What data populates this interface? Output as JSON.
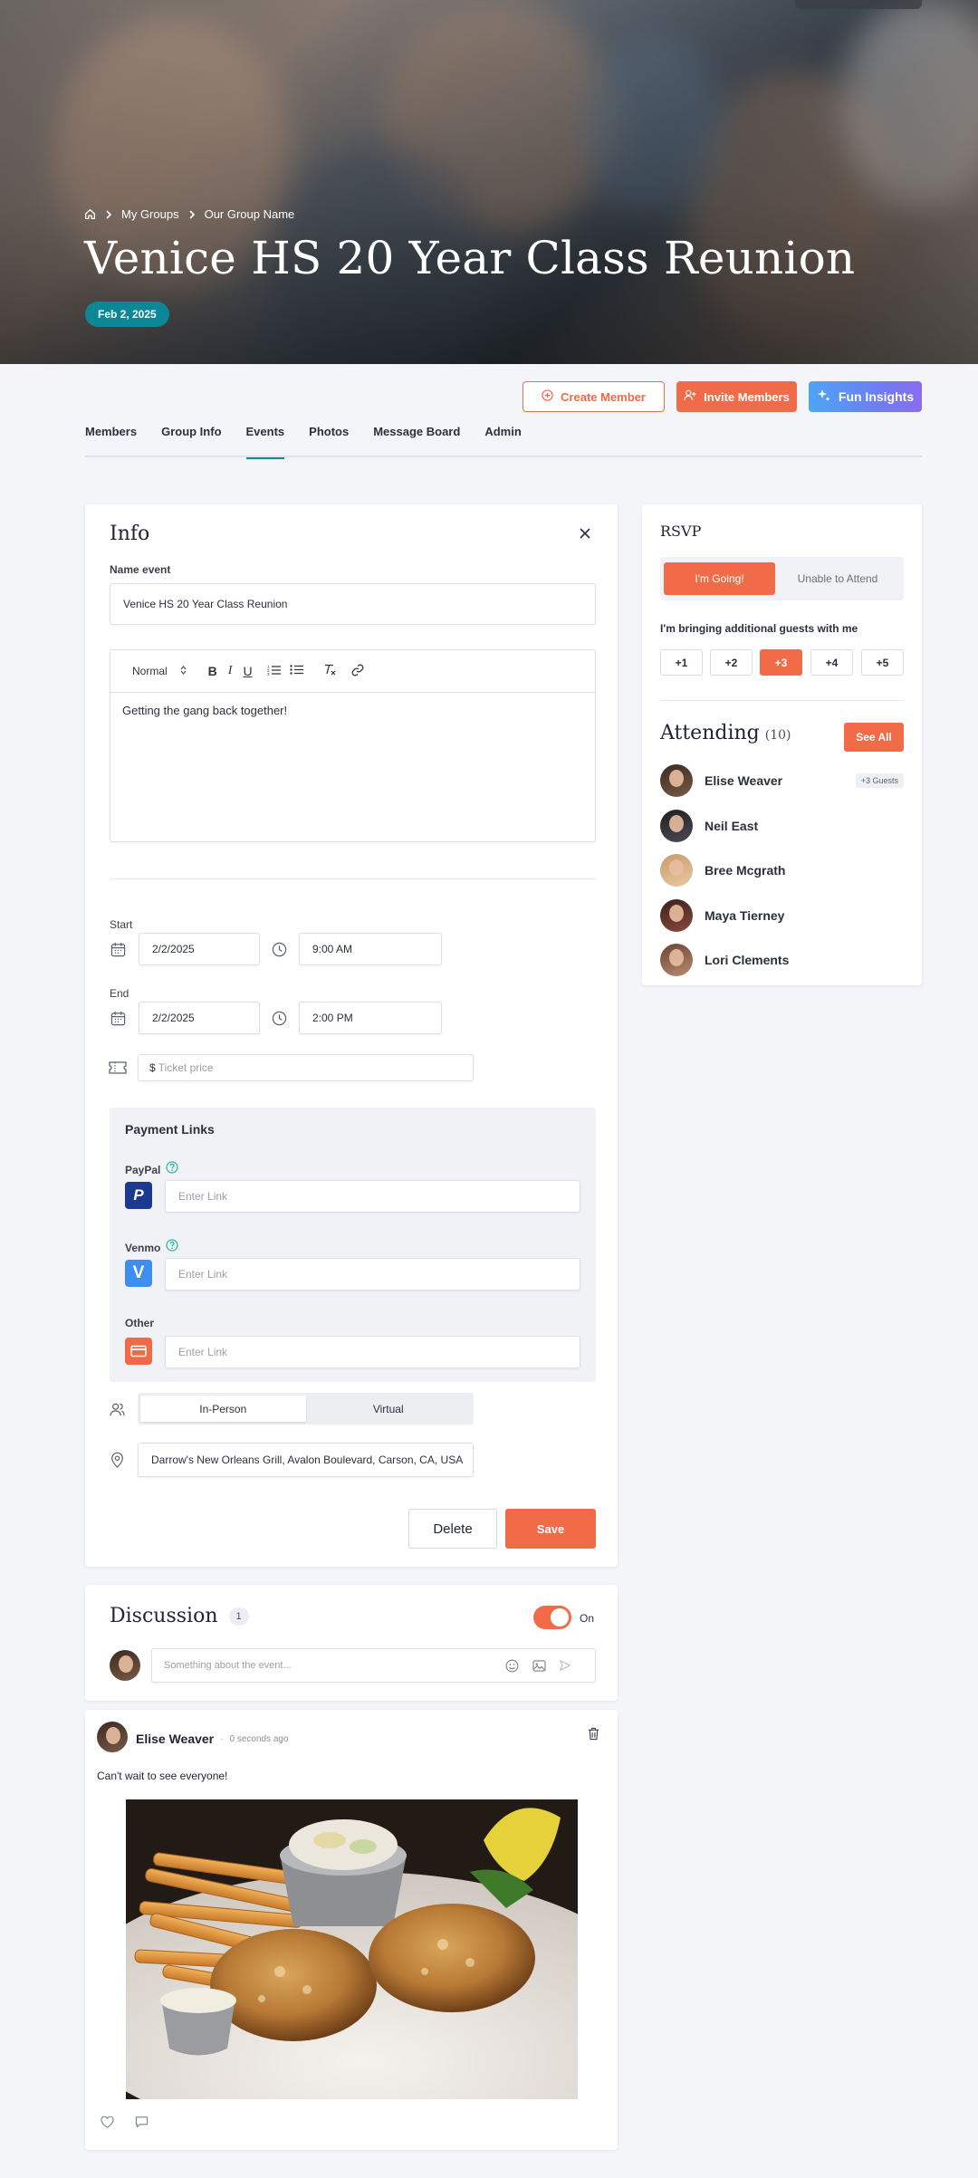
{
  "hero": {
    "breadcrumb": [
      "My Groups",
      "Our Group Name"
    ],
    "title": "Venice HS 20 Year Class Reunion",
    "date": "Feb 2, 2025"
  },
  "actions": {
    "create_member": "Create Member",
    "invite_members": "Invite Members",
    "fun_insights": "Fun Insights"
  },
  "tabs": [
    {
      "label": "Members"
    },
    {
      "label": "Group Info"
    },
    {
      "label": "Events",
      "active": true
    },
    {
      "label": "Photos"
    },
    {
      "label": "Message Board"
    },
    {
      "label": "Admin"
    }
  ],
  "info": {
    "title": "Info",
    "name_label": "Name event",
    "name_value": "Venice HS 20 Year Class Reunion",
    "editor": {
      "style": "Normal",
      "body": "Getting the gang back together!"
    },
    "start_label": "Start",
    "start_date": "2/2/2025",
    "start_time": "9:00 AM",
    "end_label": "End",
    "end_date": "2/2/2025",
    "end_time": "2:00 PM",
    "ticket_currency": "$",
    "ticket_placeholder": "Ticket price",
    "payment": {
      "title": "Payment Links",
      "paypal_label": "PayPal",
      "venmo_label": "Venmo",
      "other_label": "Other",
      "link_placeholder": "Enter Link"
    },
    "mode_options": [
      "In-Person",
      "Virtual"
    ],
    "mode_selected": "In-Person",
    "location": "Darrow's New Orleans Grill, Avalon Boulevard, Carson, CA, USA",
    "delete_label": "Delete",
    "save_label": "Save"
  },
  "rsvp": {
    "title": "RSVP",
    "going": "I'm Going!",
    "not_going": "Unable to Attend",
    "guests_label": "I'm bringing additional guests with me",
    "guest_options": [
      "+1",
      "+2",
      "+3",
      "+4",
      "+5"
    ],
    "guest_selected": "+3",
    "attending_title": "Attending",
    "attending_count": "(10)",
    "see_all": "See All",
    "attendees": [
      {
        "name": "Elise Weaver",
        "tag": "+3 Guests"
      },
      {
        "name": "Neil East"
      },
      {
        "name": "Bree Mcgrath"
      },
      {
        "name": "Maya Tierney"
      },
      {
        "name": "Lori Clements"
      }
    ]
  },
  "discussion": {
    "title": "Discussion",
    "count": "1",
    "toggle_label": "On",
    "toggle_on": true,
    "placeholder": "Something about the event..."
  },
  "post": {
    "author": "Elise Weaver",
    "separator": "·",
    "time": "0 seconds ago",
    "text": "Can't wait to see everyone!"
  },
  "colors": {
    "accent": "#f26b48",
    "teal": "#0c8796",
    "page_bg": "#f4f5f9"
  }
}
